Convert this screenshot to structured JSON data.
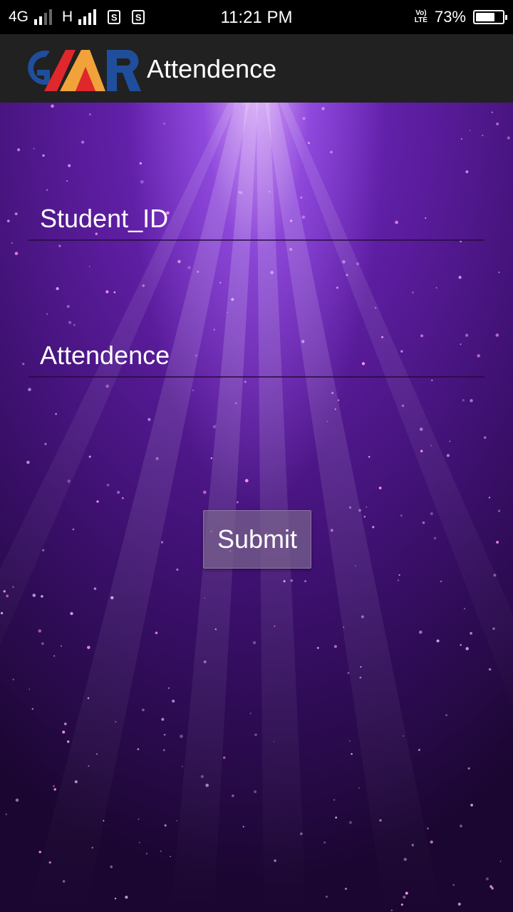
{
  "status_bar": {
    "network_1": "4G",
    "network_2": "H",
    "sim_1": "S",
    "sim_2": "S",
    "time": "11:21 PM",
    "volte_top": "Vo)",
    "volte_bottom": "LTE",
    "battery_percent": "73%",
    "battery_level": 0.73
  },
  "app_bar": {
    "logo_text": "GMR",
    "title": "Attendence"
  },
  "form": {
    "student_id_placeholder": "Student_ID",
    "attendence_placeholder": "Attendence",
    "submit_label": "Submit"
  },
  "colors": {
    "app_bar_bg": "#212121",
    "logo_blue": "#1f4e9c",
    "logo_red": "#e0282c",
    "logo_orange": "#f2a23a",
    "background_purple": "#5a1c9c"
  }
}
